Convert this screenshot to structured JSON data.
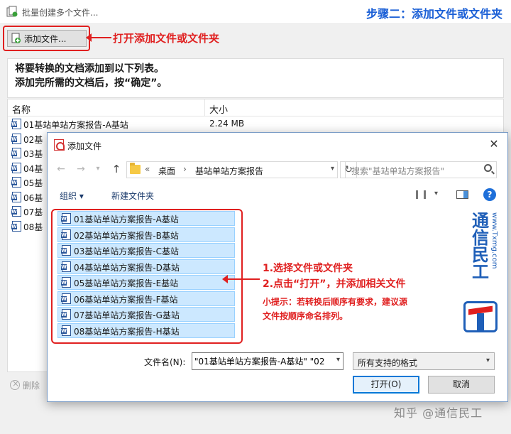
{
  "colors": {
    "accent_red": "#e02020",
    "heading_blue": "#1a5fd6",
    "selection": "#cce8ff",
    "word_blue": "#2b579a"
  },
  "window": {
    "title": "批量创建多个文件..."
  },
  "step_title": "步骤二：添加文件或文件夹",
  "add_button": {
    "label": "添加文件...",
    "icon": "add-file-icon"
  },
  "annotation_add": "打开添加文件或文件夹",
  "instructions": {
    "line1": "将要转换的文档添加到以下列表。",
    "line2": "添加完所需的文档后，按“确定”。"
  },
  "table": {
    "headers": {
      "name": "名称",
      "size": "大小"
    },
    "rows": [
      {
        "name": "01基站单站方案报告-A基站",
        "size": "2.24 MB"
      },
      {
        "name": "02基",
        "size": ""
      },
      {
        "name": "03基",
        "size": ""
      },
      {
        "name": "04基",
        "size": ""
      },
      {
        "name": "05基",
        "size": ""
      },
      {
        "name": "06基",
        "size": ""
      },
      {
        "name": "07基",
        "size": ""
      },
      {
        "name": "08基",
        "size": ""
      }
    ]
  },
  "delete_button": {
    "label": "删除"
  },
  "dialog": {
    "title": "添加文件",
    "breadcrumb": {
      "prefix": "«",
      "segments": [
        "桌面",
        "基站单站方案报告"
      ]
    },
    "search_placeholder": "搜索\"基站单站方案报告\"",
    "toolbar": {
      "organize": "组织 ▾",
      "new_folder": "新建文件夹"
    },
    "files": [
      "01基站单站方案报告-A基站",
      "02基站单站方案报告-B基站",
      "03基站单站方案报告-C基站",
      "04基站单站方案报告-D基站",
      "05基站单站方案报告-E基站",
      "06基站单站方案报告-F基站",
      "07基站单站方案报告-G基站",
      "08基站单站方案报告-H基站"
    ],
    "filename_label": "文件名(N):",
    "filename_value": "\"01基站单站方案报告-A基站\" \"02",
    "filter_value": "所有支持的格式",
    "open_label": "打开(O)",
    "cancel_label": "取消"
  },
  "annotations": {
    "select": "1.选择文件或文件夹",
    "click_open": "2.点击“打开”，并添加相关文件",
    "tip_line1": "小提示：若转换后顺序有要求，建议源",
    "tip_line2": "文件按顺序命名排列。"
  },
  "brand": {
    "name": "通信民工",
    "url": "www.Txmg.com"
  },
  "watermark": "知乎 @通信民工"
}
